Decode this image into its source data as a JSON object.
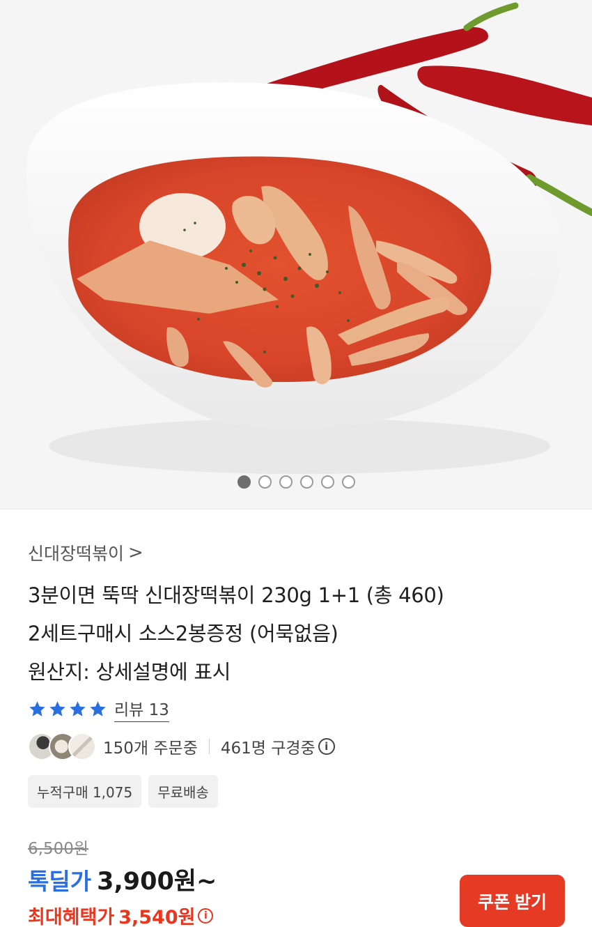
{
  "gallery": {
    "image_alt": "tteokbokki in a white bowl with red chili peppers",
    "total_slides": 6,
    "active_slide": 1
  },
  "product": {
    "brand": "신대장떡볶이",
    "brand_chevron": ">",
    "title_lines": [
      "3분이면 뚝딱 신대장떡볶이 230g 1+1 (총 460)",
      "2세트구매시 소스2봉증정 (어묵없음)",
      "원산지: 상세설명에 표시"
    ],
    "rating_stars": 4,
    "review_label": "리뷰 13"
  },
  "social": {
    "orders": "150개 주문중",
    "viewers": "461명 구경중",
    "info_icon": "i"
  },
  "tags": [
    "누적구매 1,075",
    "무료배송"
  ],
  "price": {
    "original": "6,500원",
    "deal_label": "톡딜가",
    "deal_price": "3,900원~",
    "max_label": "최대혜택가",
    "max_price": "3,540원"
  },
  "buttons": {
    "coupon": "쿠폰 받기"
  },
  "colors": {
    "accent_blue": "#2a6fe0",
    "accent_red": "#e8361f",
    "coupon_bg": "#e53a24",
    "star": "#2a6fe0"
  }
}
